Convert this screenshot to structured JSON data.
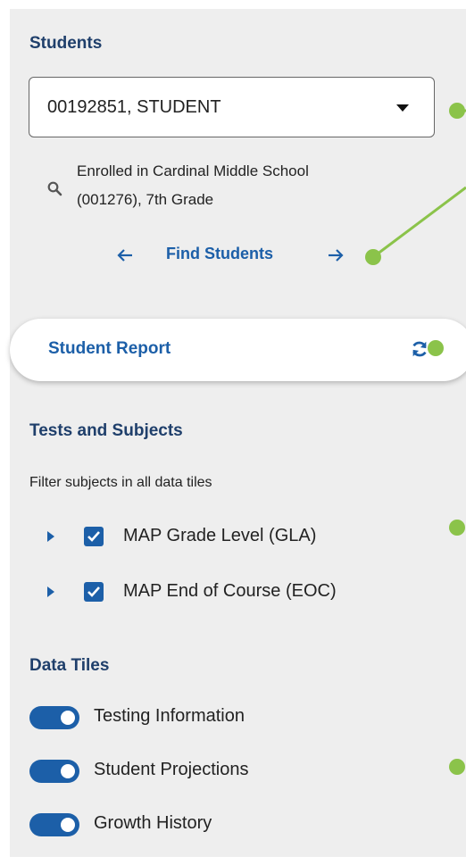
{
  "students": {
    "heading": "Students",
    "selected": "00192851, STUDENT",
    "enrollment_line1": "Enrolled in Cardinal Middle School",
    "enrollment_line2": "(001276), 7th Grade",
    "find_label": "Find Students"
  },
  "report": {
    "label": "Student Report"
  },
  "tests": {
    "heading": "Tests and Subjects",
    "filter_hint": "Filter subjects in all data tiles",
    "items": [
      {
        "label": "MAP Grade Level (GLA)",
        "checked": true
      },
      {
        "label": "MAP End of Course (EOC)",
        "checked": true
      }
    ]
  },
  "tiles": {
    "heading": "Data Tiles",
    "items": [
      {
        "label": "Testing Information",
        "on": true
      },
      {
        "label": "Student Projections",
        "on": true
      },
      {
        "label": "Growth History",
        "on": true
      }
    ]
  },
  "colors": {
    "accent": "#1c5fa8",
    "heading": "#1f3f6b",
    "panel": "#eeeeee",
    "callout": "#8bc34a"
  }
}
